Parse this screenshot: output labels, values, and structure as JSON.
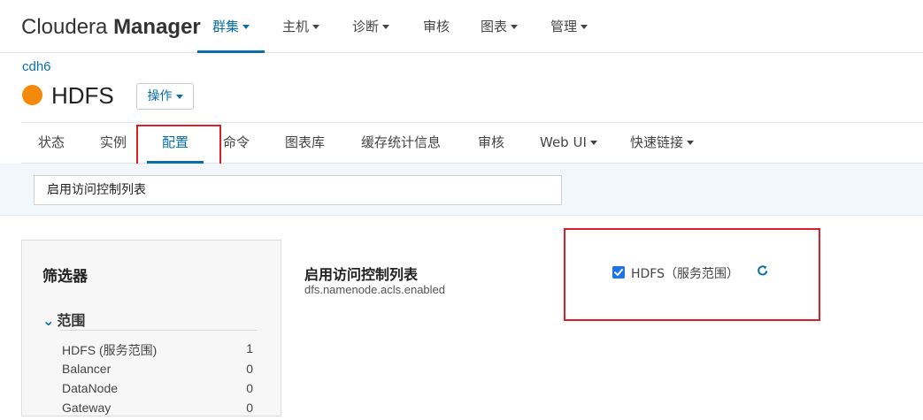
{
  "brand": {
    "prefix": "Cloudera ",
    "strong": "Manager"
  },
  "topnav": [
    {
      "label": "群集",
      "active": true,
      "caret": true
    },
    {
      "label": "主机",
      "active": false,
      "caret": true
    },
    {
      "label": "诊断",
      "active": false,
      "caret": true
    },
    {
      "label": "审核",
      "active": false,
      "caret": false
    },
    {
      "label": "图表",
      "active": false,
      "caret": true
    },
    {
      "label": "管理",
      "active": false,
      "caret": true
    }
  ],
  "breadcrumb": "cdh6",
  "service": {
    "name": "HDFS",
    "status_color": "#f58a0a",
    "actions_label": "操作"
  },
  "tabs": [
    {
      "label": "状态",
      "active": false,
      "caret": false
    },
    {
      "label": "实例",
      "active": false,
      "caret": false
    },
    {
      "label": "配置",
      "active": true,
      "caret": false
    },
    {
      "label": "命令",
      "active": false,
      "caret": false
    },
    {
      "label": "图表库",
      "active": false,
      "caret": false
    },
    {
      "label": "缓存统计信息",
      "active": false,
      "caret": false
    },
    {
      "label": "审核",
      "active": false,
      "caret": false
    },
    {
      "label": "Web UI",
      "active": false,
      "caret": true
    },
    {
      "label": "快速链接",
      "active": false,
      "caret": true
    }
  ],
  "search": {
    "value": "启用访问控制列表"
  },
  "filters": {
    "title": "筛选器",
    "scope_title": "范围",
    "scope_items": [
      {
        "label": "HDFS (服务范围)",
        "count": "1"
      },
      {
        "label": "Balancer",
        "count": "0"
      },
      {
        "label": "DataNode",
        "count": "0"
      },
      {
        "label": "Gateway",
        "count": "0"
      }
    ]
  },
  "property": {
    "display_name": "启用访问控制列表",
    "key": "dfs.namenode.acls.enabled",
    "value_label": "HDFS（服务范围）",
    "checked": true
  },
  "colors": {
    "accent": "#0a6ea8",
    "highlight": "#d6202a",
    "status": "#f58a0a"
  }
}
